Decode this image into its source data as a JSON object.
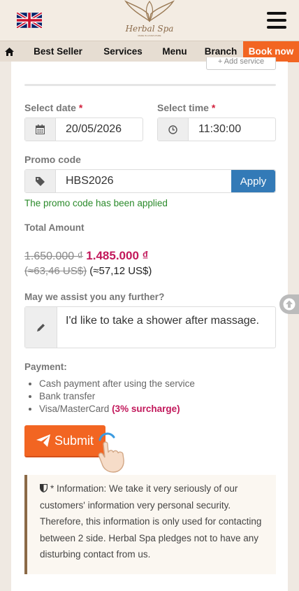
{
  "header": {
    "logo_text": "Herbal Spa",
    "logo_sub": "MADE IN LOVE'S PURE",
    "flag_icon": "uk-flag-icon",
    "menu_icon": "hamburger-icon"
  },
  "nav": {
    "home_icon": "home-icon",
    "items": [
      "Best Seller",
      "Services",
      "Menu",
      "Branch"
    ],
    "book_now": "Book now"
  },
  "form": {
    "add_service_label": "+ Add service",
    "date_label": "Select date",
    "date_value": "20/05/2026",
    "time_label": "Select time",
    "time_value": "11:30:00",
    "required_mark": "*",
    "promo_label": "Promo code",
    "promo_value": "HBS2026",
    "apply_label": "Apply",
    "promo_message": "The promo code has been applied",
    "total_label": "Total Amount",
    "old_price": "1.650.000 ₫",
    "new_price": "1.485.000 ₫",
    "old_usd": "(≈63,46 US$)",
    "new_usd": "(≈57,12 US$)",
    "assist_label": "May we assist you any further?",
    "assist_value": "I'd like to take a shower after massage.",
    "payment_label": "Payment:",
    "payment_methods": [
      "Cash payment after using the service",
      "Bank transfer",
      "Visa/MasterCard"
    ],
    "surcharge": "(3% surcharge)",
    "submit_label": "Submit",
    "info_text": "* Information: We take it very seriously of our customers' information very personal security. Therefore, this information is only used for contacting between 2 side. Herbal Spa pledges not to have any disturbing contact from us."
  },
  "colors": {
    "accent": "#f26522",
    "price": "#c2185b",
    "apply": "#337ab7",
    "success": "#2a8a2a"
  }
}
